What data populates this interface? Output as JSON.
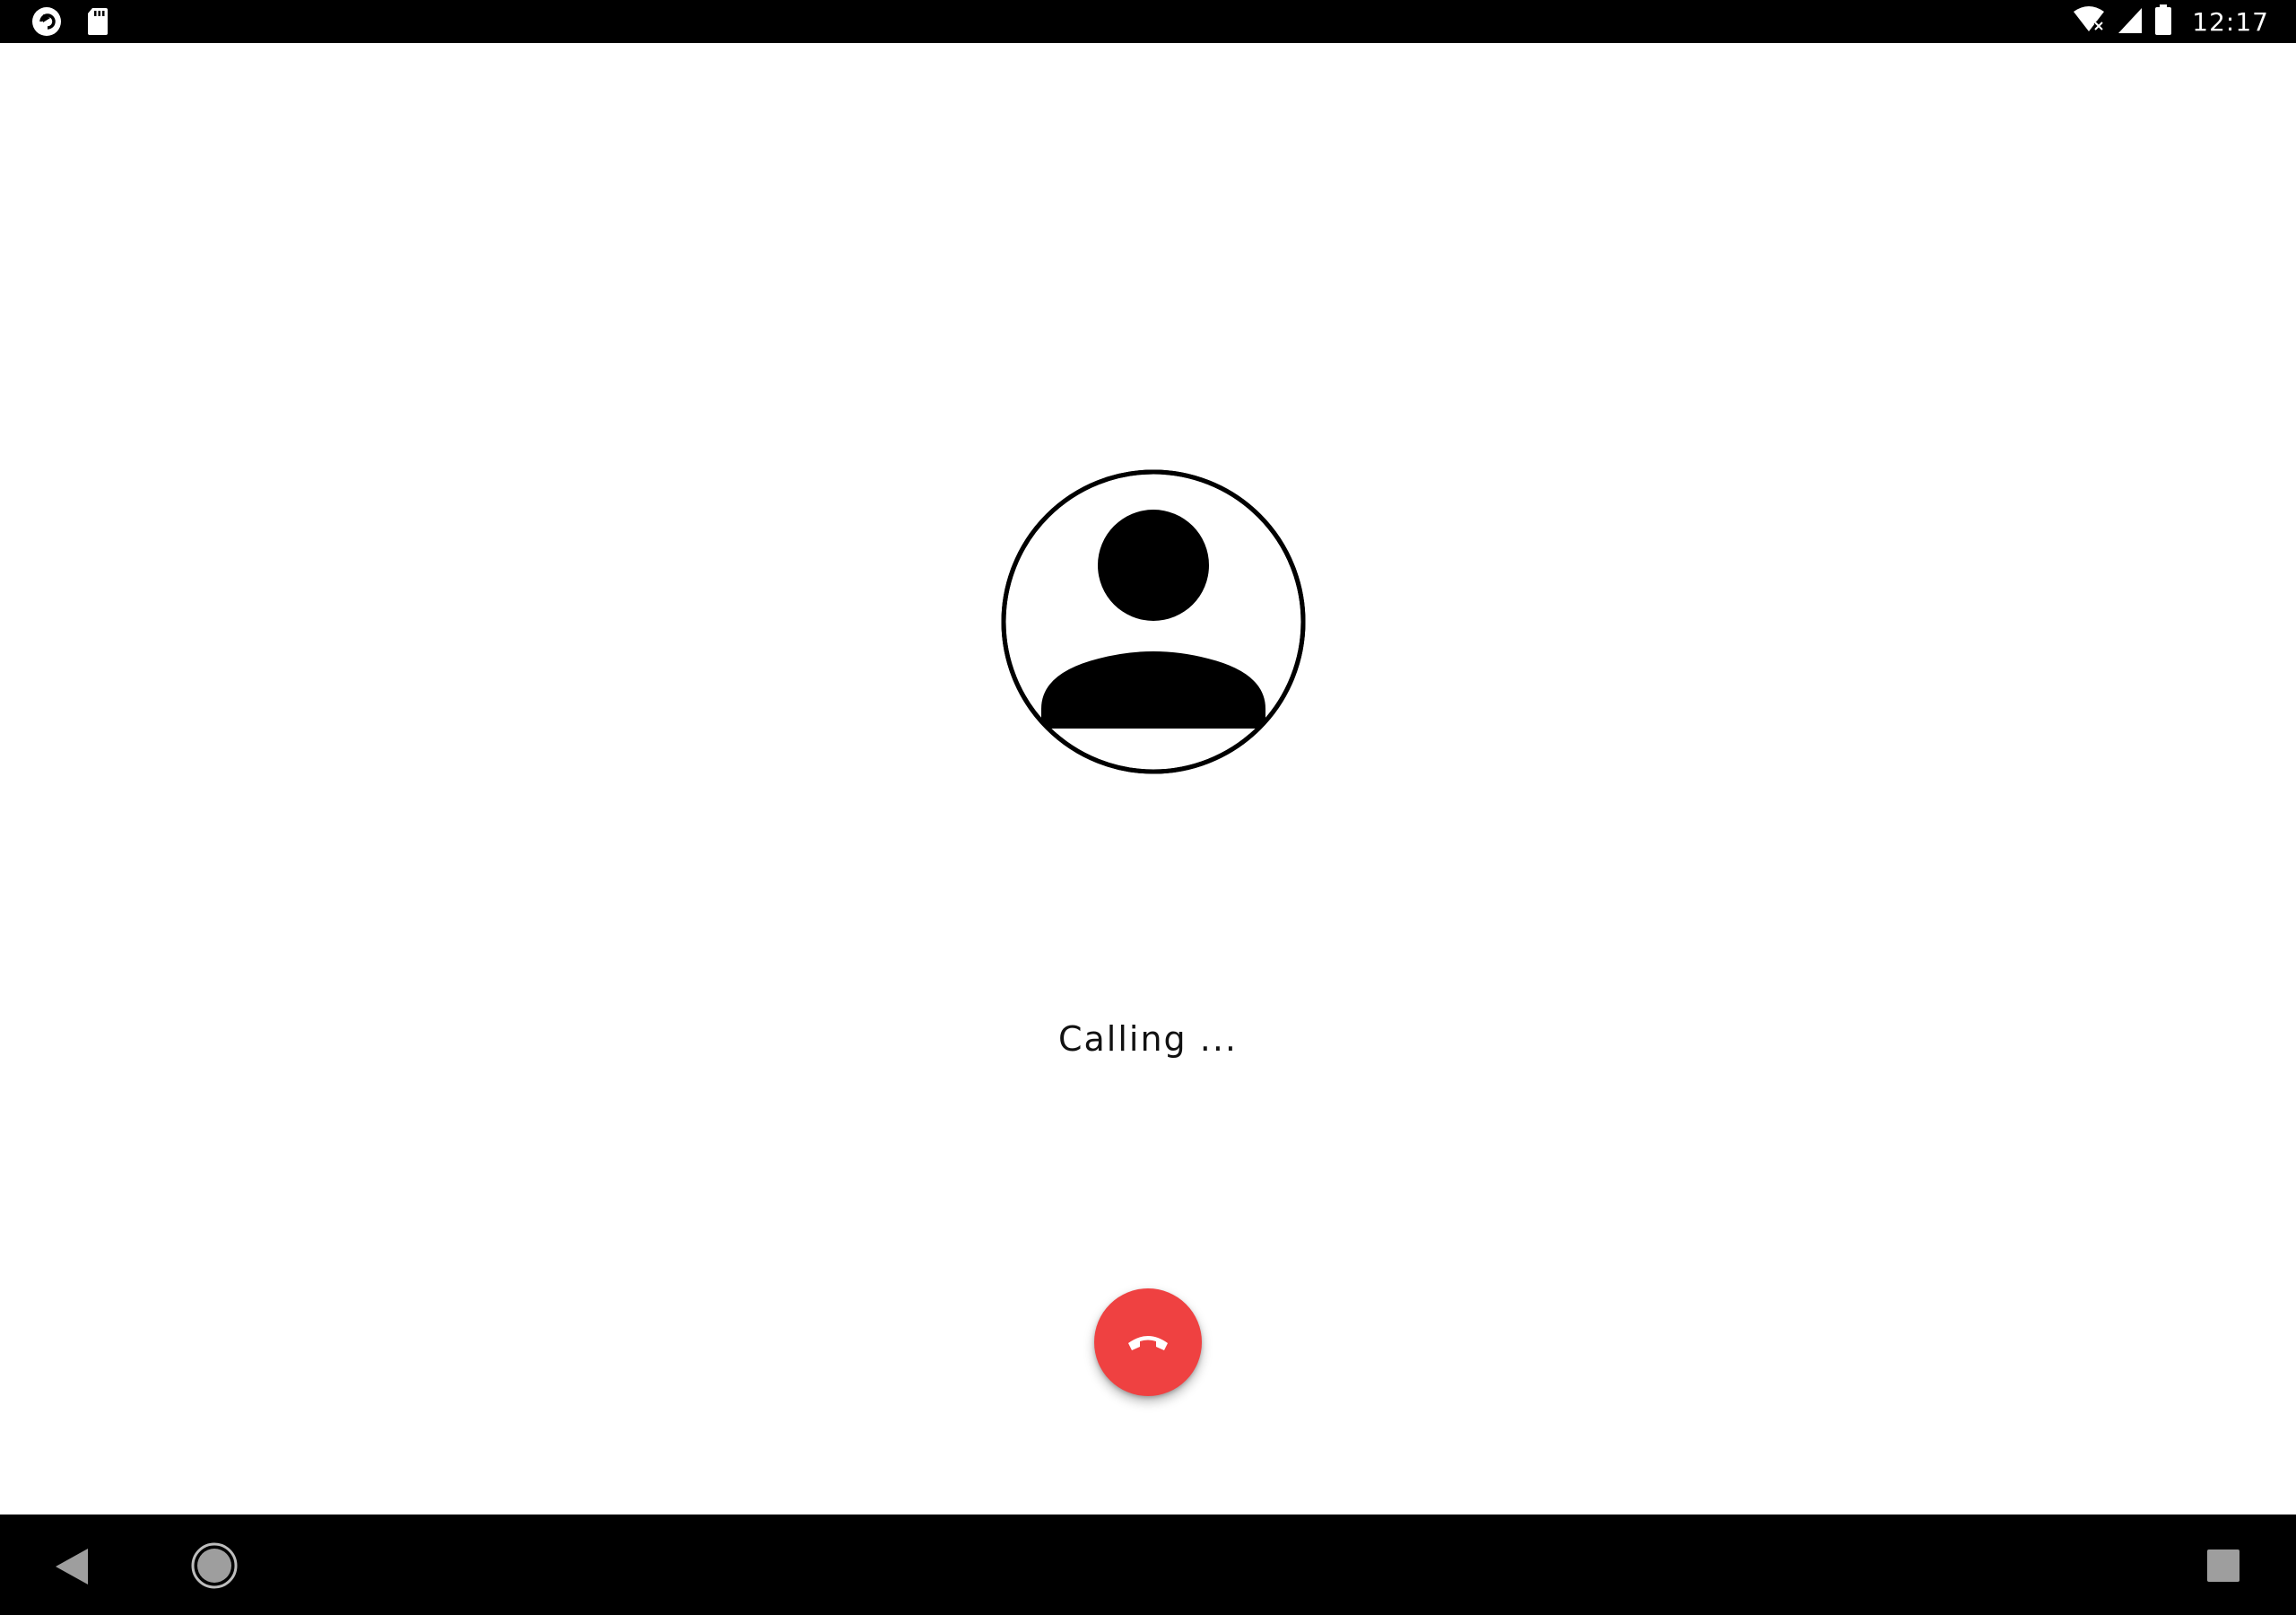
{
  "status_bar": {
    "time": "12:17",
    "icons_left": [
      "sync-app-icon",
      "sd-card-icon"
    ],
    "icons_right": [
      "wifi-no-internet-icon",
      "cell-signal-icon",
      "battery-icon"
    ]
  },
  "call": {
    "status_text": "Calling ...",
    "avatar": "default-contact-avatar-icon",
    "end_call_icon": "call-end-icon"
  },
  "colors": {
    "end_call_button": "#ef4141",
    "bars": "#000000",
    "background": "#ffffff"
  },
  "nav_bar": {
    "buttons": [
      "back-icon",
      "home-icon",
      "recents-icon"
    ]
  }
}
